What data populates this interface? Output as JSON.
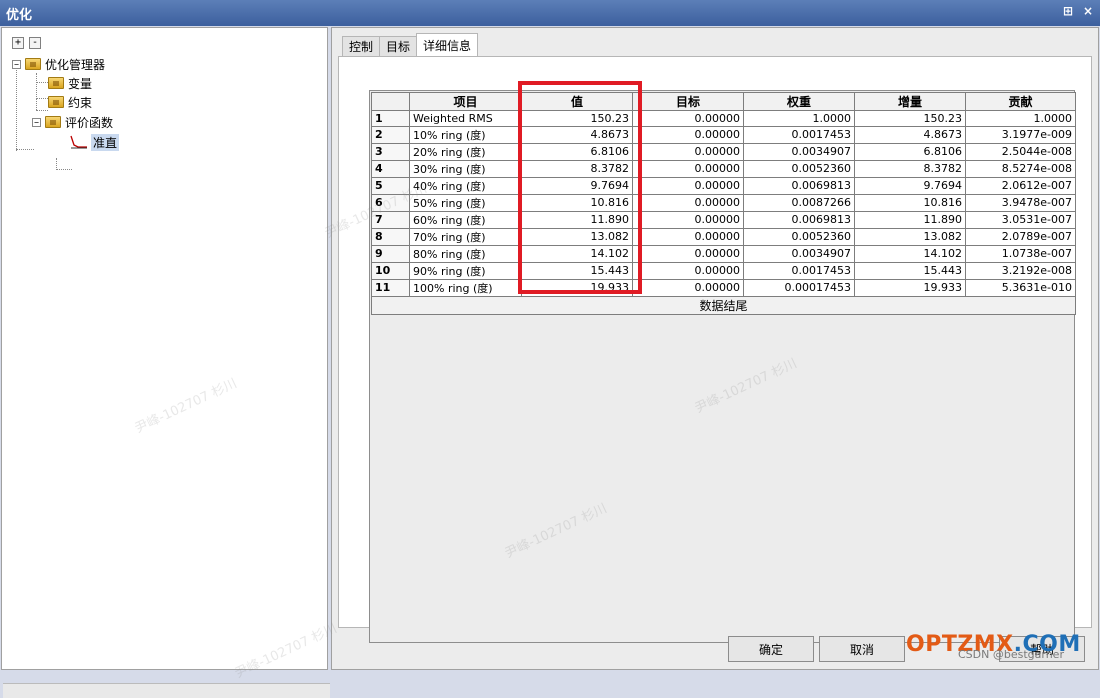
{
  "window": {
    "title": "优化",
    "pin_glyph": "⊞",
    "close_glyph": "×"
  },
  "tree": {
    "expand_label": "+",
    "collapse_label": "-",
    "nodes": [
      {
        "label": "优化管理器"
      },
      {
        "label": "变量"
      },
      {
        "label": "约束"
      },
      {
        "label": "评价函数"
      },
      {
        "label": "准直"
      }
    ]
  },
  "tabs": [
    {
      "label": "控制"
    },
    {
      "label": "目标"
    },
    {
      "label": "详细信息"
    }
  ],
  "active_tab": "详细信息",
  "grid": {
    "headers": [
      "",
      "项目",
      "值",
      "目标",
      "权重",
      "增量",
      "贡献"
    ],
    "rows": [
      [
        "1",
        "Weighted RMS",
        "150.23",
        "0.00000",
        "1.0000",
        "150.23",
        "1.0000"
      ],
      [
        "2",
        "10% ring (度)",
        "4.8673",
        "0.00000",
        "0.0017453",
        "4.8673",
        "3.1977e-009"
      ],
      [
        "3",
        "20% ring (度)",
        "6.8106",
        "0.00000",
        "0.0034907",
        "6.8106",
        "2.5044e-008"
      ],
      [
        "4",
        "30% ring (度)",
        "8.3782",
        "0.00000",
        "0.0052360",
        "8.3782",
        "8.5274e-008"
      ],
      [
        "5",
        "40% ring (度)",
        "9.7694",
        "0.00000",
        "0.0069813",
        "9.7694",
        "2.0612e-007"
      ],
      [
        "6",
        "50% ring (度)",
        "10.816",
        "0.00000",
        "0.0087266",
        "10.816",
        "3.9478e-007"
      ],
      [
        "7",
        "60% ring (度)",
        "11.890",
        "0.00000",
        "0.0069813",
        "11.890",
        "3.0531e-007"
      ],
      [
        "8",
        "70% ring (度)",
        "13.082",
        "0.00000",
        "0.0052360",
        "13.082",
        "2.0789e-007"
      ],
      [
        "9",
        "80% ring (度)",
        "14.102",
        "0.00000",
        "0.0034907",
        "14.102",
        "1.0738e-007"
      ],
      [
        "10",
        "90% ring (度)",
        "15.443",
        "0.00000",
        "0.0017453",
        "15.443",
        "3.2192e-008"
      ],
      [
        "11",
        "100% ring (度)",
        "19.933",
        "0.00000",
        "0.00017453",
        "19.933",
        "5.3631e-010"
      ]
    ],
    "footer": "数据结尾"
  },
  "buttons": {
    "ok": "确定",
    "cancel": "取消",
    "help": "帮助"
  },
  "branding": {
    "logo_main": "OPTZMX",
    "logo_suffix": ".COM",
    "credit": "CSDN @bestgarner"
  },
  "watermark": "尹峰-102707 杉川",
  "colors": {
    "highlight": "#e01b24",
    "titlebar": "#3c5f9e",
    "logo": "#e35b16"
  }
}
